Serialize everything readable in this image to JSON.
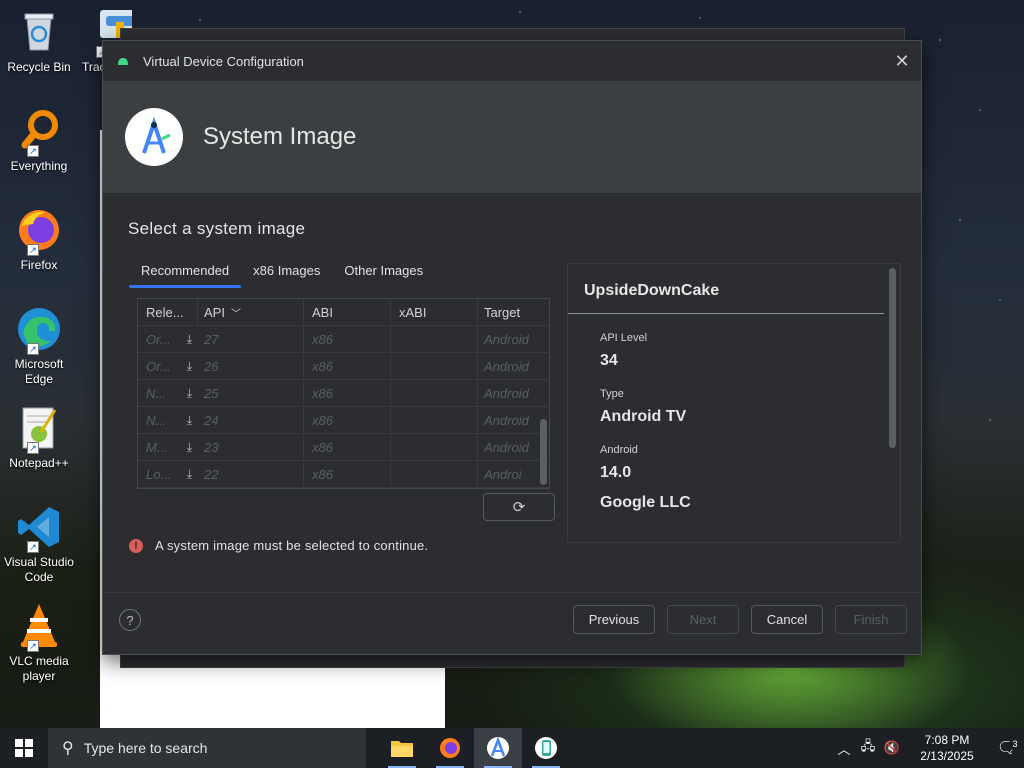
{
  "desktop": {
    "icons": [
      {
        "label": "Recycle Bin"
      },
      {
        "label": "Everything"
      },
      {
        "label": "Firefox"
      },
      {
        "label": "Microsoft Edge"
      },
      {
        "label": "Notepad++"
      },
      {
        "label": "Visual Studio Code"
      },
      {
        "label": "VLC media player"
      },
      {
        "label": "Trac"
      }
    ]
  },
  "dialog": {
    "window_title": "Virtual Device Configuration",
    "header_title": "System Image",
    "section_title": "Select a system image",
    "tabs": [
      {
        "label": "Recommended",
        "active": true
      },
      {
        "label": "x86 Images",
        "active": false
      },
      {
        "label": "Other Images",
        "active": false
      }
    ],
    "table": {
      "columns": [
        "Rele...",
        "API",
        "ABI",
        "xABI",
        "Target"
      ],
      "sort_indicator": "chevron-down",
      "rows": [
        {
          "release": "Or...",
          "api": "27",
          "abi": "x86",
          "xabi": "",
          "target": "Android"
        },
        {
          "release": "Or...",
          "api": "26",
          "abi": "x86",
          "xabi": "",
          "target": "Android"
        },
        {
          "release": "N...",
          "api": "25",
          "abi": "x86",
          "xabi": "",
          "target": "Android"
        },
        {
          "release": "N...",
          "api": "24",
          "abi": "x86",
          "xabi": "",
          "target": "Android"
        },
        {
          "release": "M...",
          "api": "23",
          "abi": "x86",
          "xabi": "",
          "target": "Android"
        },
        {
          "release": "Lo...",
          "api": "22",
          "abi": "x86",
          "xabi": "",
          "target": "Androi"
        }
      ]
    },
    "details": {
      "title": "UpsideDownCake",
      "fields": [
        {
          "label": "API Level",
          "value": "34"
        },
        {
          "label": "Type",
          "value": "Android TV"
        },
        {
          "label": "Android",
          "value": "14.0"
        }
      ],
      "vendor": "Google LLC"
    },
    "error_message": "A system image must be selected to continue.",
    "buttons": {
      "help": "?",
      "previous": "Previous",
      "next": "Next",
      "cancel": "Cancel",
      "finish": "Finish"
    },
    "colors": {
      "accent": "#3574f0",
      "error": "#db5c5c",
      "background": "#2b2d30",
      "header": "#3c3f41"
    }
  },
  "taskbar": {
    "search_placeholder": "Type here to search",
    "apps": [
      "file-explorer",
      "firefox",
      "android-studio",
      "emulator"
    ],
    "time": "7:08 PM",
    "date": "2/13/2025",
    "notification_count": "3"
  }
}
